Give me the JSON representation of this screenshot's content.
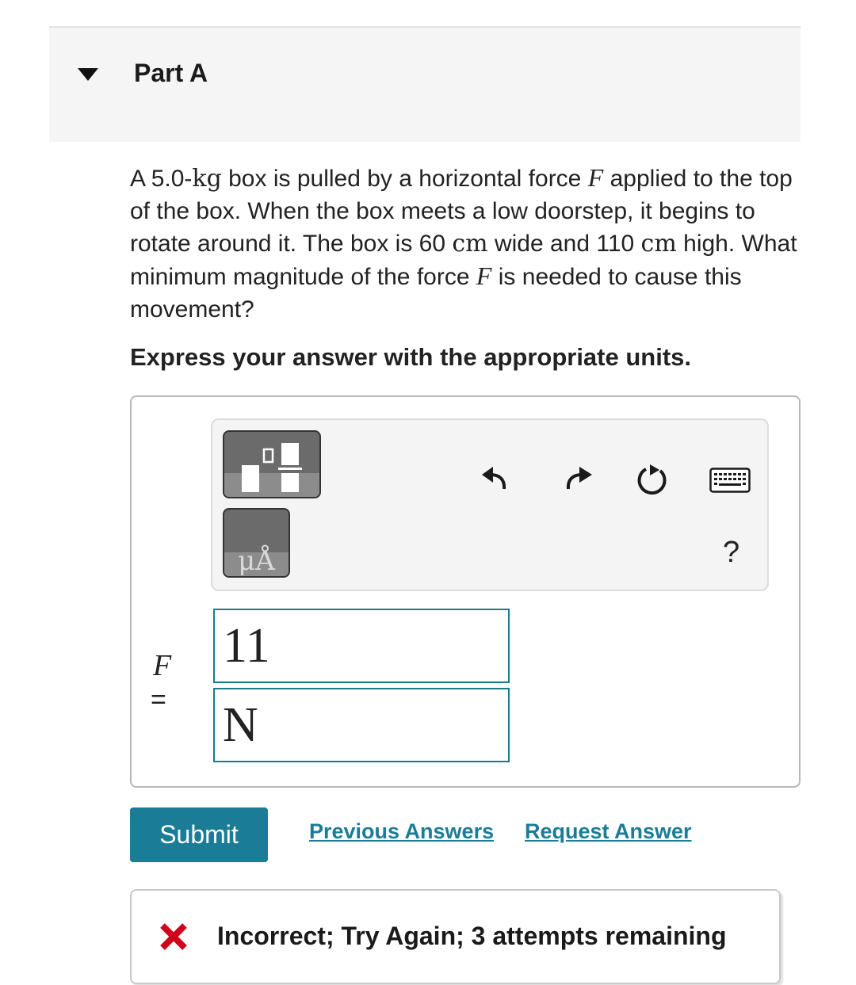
{
  "part": {
    "title": "Part A"
  },
  "question": {
    "seg1": "A 5.0-",
    "unit_kg": "kg",
    "seg2": " box is pulled by a horizontal force ",
    "var_F": "F",
    "seg3": " applied to the top of the box. When the box meets a low doorstep, it begins to rotate around it. The box is 60 ",
    "unit_cm": "cm",
    "seg4": " wide and 110 ",
    "seg5": " high. What minimum magnitude of the force ",
    "seg6": " is needed to cause this movement?"
  },
  "instruction": "Express your answer with the appropriate units.",
  "toolbar": {
    "units_label": "μÅ",
    "help_label": "?"
  },
  "answer": {
    "variable": "F",
    "equals": "=",
    "value": "11",
    "unit": "N"
  },
  "actions": {
    "submit_label": "Submit",
    "previous_answers_label": "Previous Answers",
    "request_answer_label": "Request Answer"
  },
  "feedback": {
    "text": "Incorrect; Try Again; 3 attempts remaining",
    "color": "#d0021b"
  },
  "colors": {
    "accent": "#1b7c98",
    "input_border": "#1a7a8a"
  }
}
